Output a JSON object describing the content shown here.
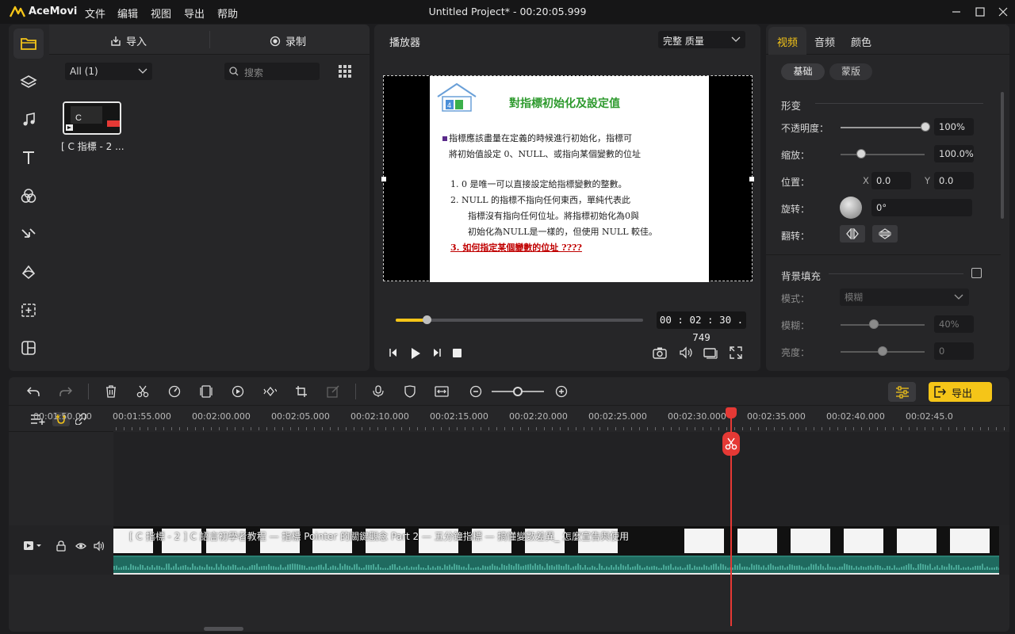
{
  "app": {
    "name": "AceMovi",
    "window_title": "Untitled Project* - 00:20:05.999",
    "menu": [
      "文件",
      "编辑",
      "视图",
      "导出",
      "帮助"
    ]
  },
  "media_panel": {
    "import_label": "导入",
    "record_label": "录制",
    "filter_value": "All (1)",
    "search_placeholder": "搜索",
    "item_label": "[ C 指標 - 2 ..."
  },
  "player": {
    "title": "播放器",
    "quality": "完整 质量",
    "timecode": "00 : 02 : 30 . 749",
    "progress": 0.125,
    "slide": {
      "title": "對指標初始化及設定值",
      "bullet_line1": "指標應該盡量在定義的時候進行初始化，指標可",
      "bullet_line2": "將初始值設定 0、NULL、或指向某個變數的位址",
      "item1": "1.  0 是唯一可以直接設定給指標變數的整數。",
      "item2a": "2. NULL  的指標不指向任何東西，單純代表此",
      "item2b": "指標沒有指向任何位址。將指標初始化為0與",
      "item2c": "初始化為NULL是一樣的，但使用 NULL 較佳。",
      "item3": "3.  如何指定某個變數的位址 ????"
    }
  },
  "properties": {
    "tabs": [
      "视频",
      "音频",
      "颜色"
    ],
    "subtabs": [
      "基础",
      "蒙版"
    ],
    "transform_header": "形变",
    "opacity_label": "不透明度：",
    "opacity_value": "100%",
    "scale_label": "缩放：",
    "scale_value": "100.0%",
    "position_label": "位置：",
    "pos_x_label": "X",
    "pos_x": "0.0",
    "pos_y_label": "Y",
    "pos_y": "0.0",
    "rotation_label": "旋转：",
    "rotation_value": "0°",
    "flip_label": "翻转：",
    "bg_fill_header": "背景填充",
    "style_label": "模式：",
    "style_value": "模糊",
    "blur_label": "模糊：",
    "blur_value": "40%",
    "brightness_label": "亮度：",
    "brightness_value": "0"
  },
  "timeline": {
    "export_label": "导出",
    "ruler": [
      "00:01:50.000",
      "00:01:55.000",
      "00:02:00.000",
      "00:02:05.000",
      "00:02:10.000",
      "00:02:15.000",
      "00:02:20.000",
      "00:02:25.000",
      "00:02:30.000",
      "00:02:35.000",
      "00:02:40.000",
      "00:02:45.0"
    ],
    "track_number": "1",
    "clip_title": "[ C 指標 - 2 ] C 語言初學者教程 — 指標 Pointer 的關鍵觀念 Part 2 — 五分鐘指標 — 搞懂變數差異_ 怎麼宣告與使用"
  },
  "colors": {
    "accent": "#f5c518",
    "playhead": "#e53935",
    "audio": "#1f6a5f",
    "slide_title": "#2e9a2e",
    "slide_red": "#c00000"
  }
}
